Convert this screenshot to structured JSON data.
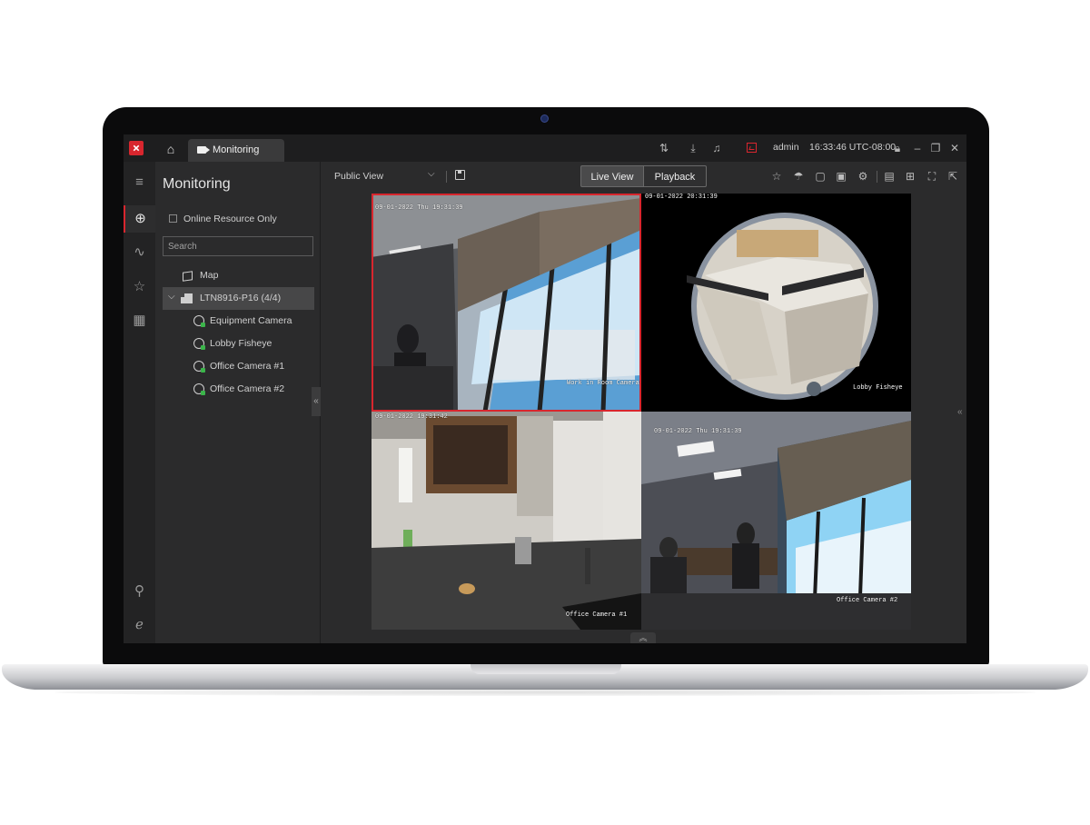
{
  "app": {
    "tab_label": "Monitoring",
    "user": "admin",
    "clock": "16:33:46 UTC-08:00"
  },
  "side_panel": {
    "title": "Monitoring",
    "online_only_label": "Online Resource Only",
    "search_placeholder": "Search",
    "map_label": "Map",
    "device_label": "LTN8916-P16 (4/4)",
    "cameras": [
      "Equipment Camera",
      "Lobby Fisheye",
      "Office Camera #1",
      "Office Camera #2"
    ]
  },
  "toolbar": {
    "view_name": "Public View",
    "live_label": "Live View",
    "playback_label": "Playback"
  },
  "tiles": [
    {
      "timestamp": "09-01-2022 Thu 19:31:39",
      "overlay_name": "Work in Room Camera"
    },
    {
      "timestamp": "09-01-2022 20:31:39",
      "overlay_name": "Lobby Fisheye"
    },
    {
      "timestamp": "09-01-2022 19:31:42",
      "overlay_name": "Office Camera #1"
    },
    {
      "timestamp": "09-01-2022 Thu 19:31:39",
      "overlay_name": "Office Camera #2"
    }
  ],
  "colors": {
    "accent": "#d8262e",
    "online": "#3bb54a",
    "window_bg": "#2b2b2c"
  }
}
